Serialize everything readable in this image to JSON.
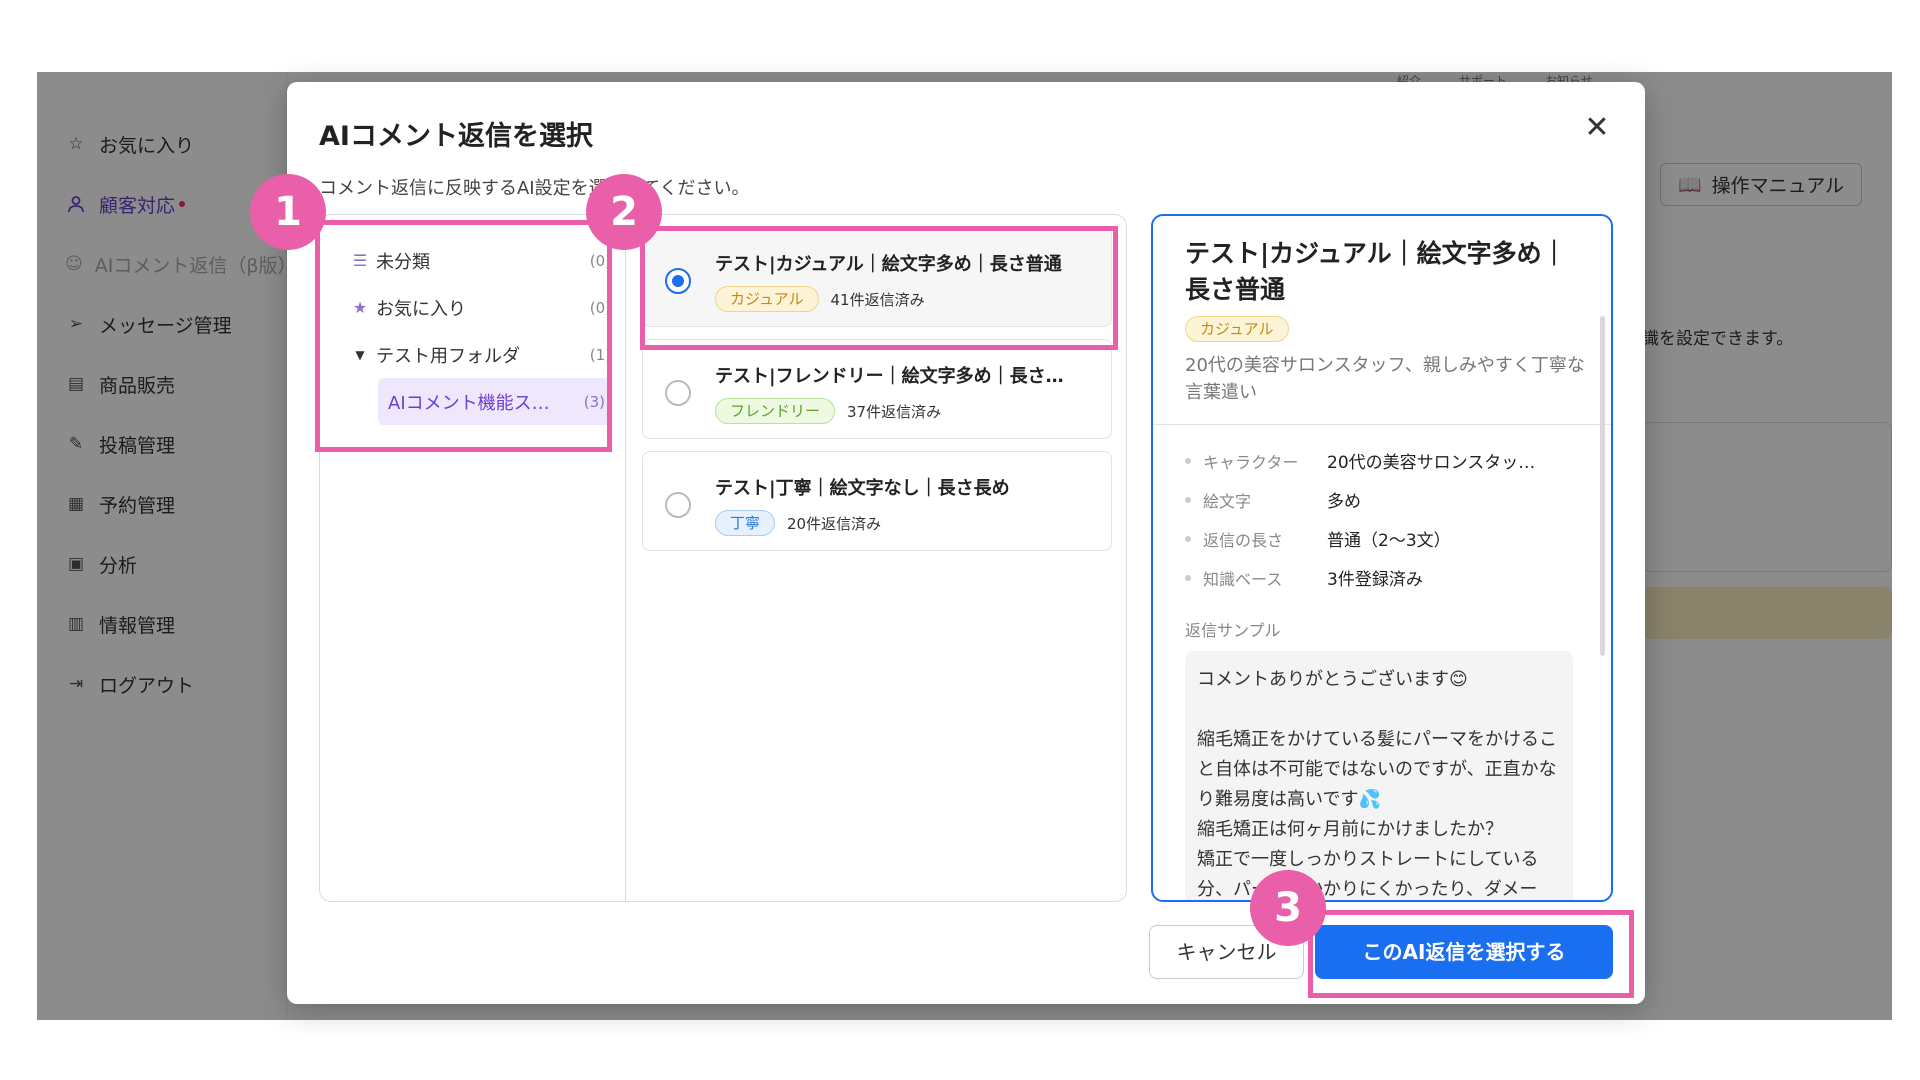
{
  "topnav": [
    "紹介",
    "サポート",
    "お知らせ"
  ],
  "sidebar": {
    "items": [
      {
        "label": "お気に入り",
        "icon": "star-outline-icon"
      },
      {
        "label": "顧客対応",
        "icon": "user-icon"
      },
      {
        "label": "AIコメント返信（β版）",
        "icon": "chat-bot-icon"
      },
      {
        "label": "メッセージ管理",
        "icon": "send-icon"
      },
      {
        "label": "商品販売",
        "icon": "store-icon"
      },
      {
        "label": "投稿管理",
        "icon": "edit-icon"
      },
      {
        "label": "予約管理",
        "icon": "calendar-icon"
      },
      {
        "label": "分析",
        "icon": "analysis-icon"
      },
      {
        "label": "情報管理",
        "icon": "bar-chart-icon"
      },
      {
        "label": "ログアウト",
        "icon": "logout-icon"
      }
    ]
  },
  "background": {
    "manual_label": "操作マニュアル",
    "hint_text": "識を設定できます。"
  },
  "modal": {
    "title": "AIコメント返信を選択",
    "subtitle": "コメント返信に反映するAI設定を選択してください。",
    "folders": [
      {
        "label": "未分類",
        "count": "(0)",
        "icon": "list-icon"
      },
      {
        "label": "お気に入り",
        "count": "(0)",
        "icon": "star-icon"
      },
      {
        "label": "テスト用フォルダ",
        "count": "(1)",
        "icon": "caret-down-icon"
      },
      {
        "label": "AIコメント機能ス…",
        "count": "(3)"
      }
    ],
    "replies": [
      {
        "title": "テスト|カジュアル｜絵文字多め｜長さ普通",
        "tag": "カジュアル",
        "count": "41件返信済み",
        "selected": true
      },
      {
        "title": "テスト|フレンドリー｜絵文字多め｜長さ…",
        "tag": "フレンドリー",
        "count": "37件返信済み",
        "selected": false
      },
      {
        "title": "テスト|丁寧｜絵文字なし｜長さ長め",
        "tag": "丁寧",
        "count": "20件返信済み",
        "selected": false
      }
    ],
    "detail": {
      "title": "テスト|カジュアル｜絵文字多め｜長さ普通",
      "tag": "カジュアル",
      "description": "20代の美容サロンスタッフ、親しみやすく丁寧な言葉遣い",
      "attributes": [
        {
          "key": "キャラクター",
          "value": "20代の美容サロンスタッ…"
        },
        {
          "key": "絵文字",
          "value": "多め"
        },
        {
          "key": "返信の長さ",
          "value": "普通（2〜3文）"
        },
        {
          "key": "知識ベース",
          "value": "3件登録済み"
        }
      ],
      "sample_label": "返信サンプル",
      "sample_text": "コメントありがとうございます😊\n\n縮毛矯正をかけている髪にパーマをかけること自体は不可能ではないのですが、正直かなり難易度は高いです💦\n縮毛矯正は何ヶ月前にかけましたか？\n矯正で一度しっかりストレートにしている分、パーマがかかりにくかったり、ダメー"
    },
    "cancel_label": "キャンセル",
    "confirm_label": "このAI返信を選択する"
  },
  "annotations": [
    "1",
    "2",
    "3"
  ],
  "colors": {
    "accent": "#1a6ff0",
    "highlight": "#ea5fa9",
    "active_nav": "#6b3fd6"
  }
}
